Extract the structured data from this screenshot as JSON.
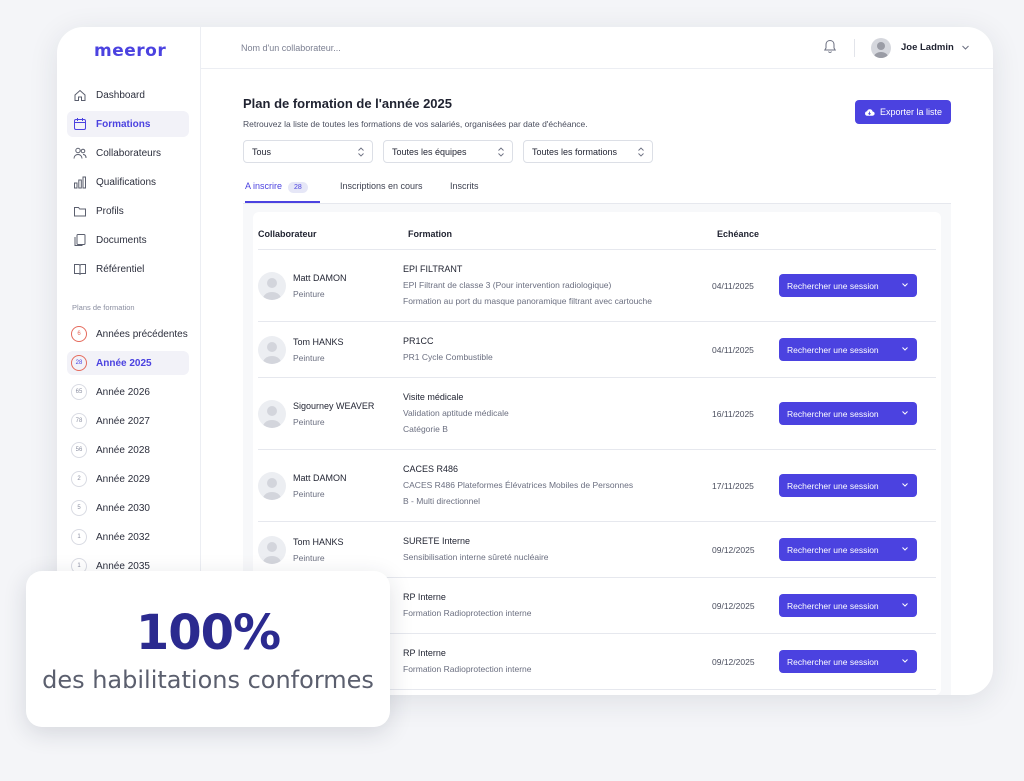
{
  "app": {
    "logo": "meeror"
  },
  "colors": {
    "accent": "#4b42e0",
    "warning": "#e56b5d",
    "promo_text": "#2b2a8f"
  },
  "sidebar": {
    "items": [
      {
        "label": "Dashboard",
        "icon": "home-icon",
        "active": false
      },
      {
        "label": "Formations",
        "icon": "calendar-icon",
        "active": true
      },
      {
        "label": "Collaborateurs",
        "icon": "users-icon",
        "active": false
      },
      {
        "label": "Qualifications",
        "icon": "bar-chart-icon",
        "active": false
      },
      {
        "label": "Profils",
        "icon": "folder-icon",
        "active": false
      },
      {
        "label": "Documents",
        "icon": "documents-icon",
        "active": false
      },
      {
        "label": "Référentiel",
        "icon": "book-icon",
        "active": false
      }
    ],
    "section_title": "Plans de formation",
    "years": [
      {
        "badge": "6",
        "label": "Années précédentes",
        "state": "warn"
      },
      {
        "badge": "28",
        "label": "Année 2025",
        "state": "active"
      },
      {
        "badge": "65",
        "label": "Année 2026",
        "state": "normal"
      },
      {
        "badge": "78",
        "label": "Année 2027",
        "state": "normal"
      },
      {
        "badge": "56",
        "label": "Année 2028",
        "state": "normal"
      },
      {
        "badge": "2",
        "label": "Année 2029",
        "state": "normal"
      },
      {
        "badge": "5",
        "label": "Année 2030",
        "state": "normal"
      },
      {
        "badge": "1",
        "label": "Année 2032",
        "state": "normal"
      },
      {
        "badge": "1",
        "label": "Année 2035",
        "state": "normal"
      }
    ]
  },
  "topbar": {
    "search_placeholder": "Nom d'un collaborateur...",
    "user_name": "Joe Ladmin"
  },
  "main": {
    "title": "Plan de formation de l'année 2025",
    "subtitle": "Retrouvez la liste de toutes les formations de vos salariés, organisées par date d'échéance.",
    "export_label": "Exporter la liste",
    "filters": [
      "Tous",
      "Toutes les équipes",
      "Toutes les formations"
    ],
    "tabs": [
      {
        "label": "A inscrire",
        "count": "28",
        "active": true
      },
      {
        "label": "Inscriptions en cours",
        "count": "",
        "active": false
      },
      {
        "label": "Inscrits",
        "count": "",
        "active": false
      }
    ],
    "table": {
      "headers": [
        "Collaborateur",
        "Formation",
        "Echéance"
      ],
      "action_label": "Rechercher une session",
      "rows": [
        {
          "name": "Matt DAMON",
          "team": "Peinture",
          "formation": "EPI FILTRANT",
          "lines": [
            "EPI Filtrant de classe 3 (Pour intervention radiologique)",
            "Formation au port du masque panoramique filtrant avec cartouche"
          ],
          "date": "04/11/2025"
        },
        {
          "name": "Tom HANKS",
          "team": "Peinture",
          "formation": "PR1CC",
          "lines": [
            "PR1 Cycle Combustible"
          ],
          "date": "04/11/2025"
        },
        {
          "name": "Sigourney WEAVER",
          "team": "Peinture",
          "formation": "Visite médicale",
          "lines": [
            "Validation aptitude médicale",
            "Catégorie B"
          ],
          "date": "16/11/2025"
        },
        {
          "name": "Matt DAMON",
          "team": "Peinture",
          "formation": "CACES R486",
          "lines": [
            "CACES R486 Plateformes Élévatrices Mobiles de Personnes",
            "B - Multi directionnel"
          ],
          "date": "17/11/2025"
        },
        {
          "name": "Tom HANKS",
          "team": "Peinture",
          "formation": "SURETE Interne",
          "lines": [
            "Sensibilisation interne sûreté nucléaire"
          ],
          "date": "09/12/2025"
        },
        {
          "name": "",
          "team": "",
          "formation": "RP Interne",
          "lines": [
            "Formation Radioprotection interne"
          ],
          "date": "09/12/2025"
        },
        {
          "name": "",
          "team": "",
          "formation": "RP Interne",
          "lines": [
            "Formation Radioprotection interne"
          ],
          "date": "09/12/2025"
        }
      ]
    }
  },
  "promo": {
    "big": "100%",
    "small": "des habilitations conformes"
  }
}
